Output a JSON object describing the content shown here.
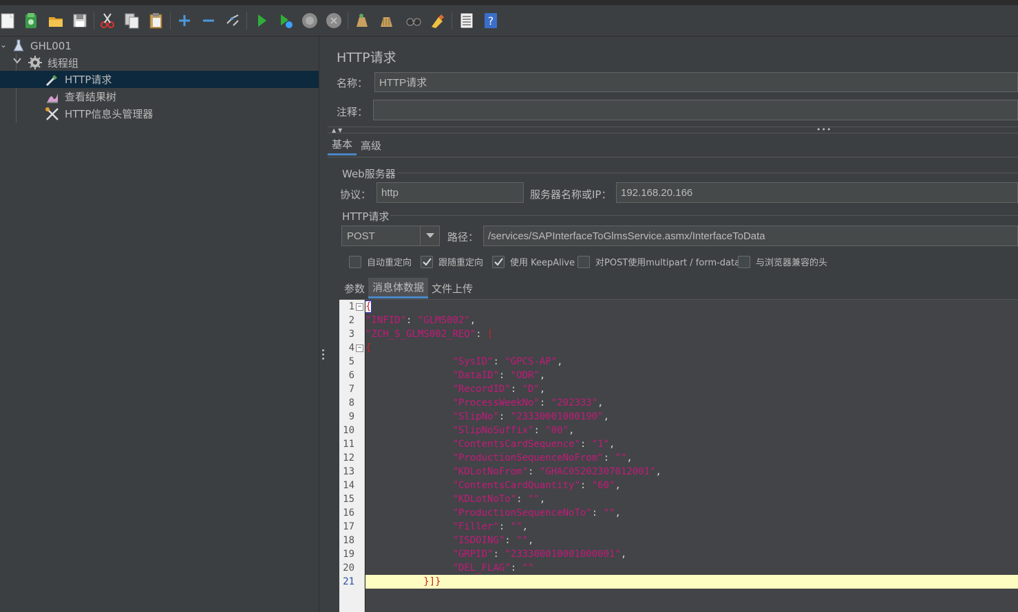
{
  "tree": {
    "root": {
      "label": "GHL001"
    },
    "thread_group": {
      "label": "线程组"
    },
    "items": [
      {
        "label": "HTTP请求",
        "selected": true
      },
      {
        "label": "查看结果树",
        "selected": false
      },
      {
        "label": "HTTP信息头管理器",
        "selected": false
      }
    ]
  },
  "panel": {
    "title": "HTTP请求",
    "name_label": "名称：",
    "name_value": "HTTP请求",
    "comment_label": "注释：",
    "comment_value": ""
  },
  "tabs": {
    "basic": "基本",
    "advanced": "高级"
  },
  "web_server": {
    "group_title": "Web服务器",
    "protocol_label": "协议：",
    "protocol_value": "http",
    "server_label": "服务器名称或IP：",
    "server_value": "192.168.20.166"
  },
  "http_request": {
    "group_title": "HTTP请求",
    "method": "POST",
    "path_label": "路径：",
    "path_value": "/services/SAPInterfaceToGlmsService.asmx/InterfaceToData"
  },
  "options": [
    {
      "label": "自动重定向",
      "checked": false
    },
    {
      "label": "跟随重定向",
      "checked": true
    },
    {
      "label": "使用 KeepAlive",
      "checked": true
    },
    {
      "label": "对POST使用multipart / form-data",
      "checked": false
    },
    {
      "label": "与浏览器兼容的头",
      "checked": false
    }
  ],
  "body_tabs": {
    "params": "参数",
    "body": "消息体数据",
    "files": "文件上传"
  },
  "editor": {
    "current_line": 21,
    "lines": [
      "1",
      "2",
      "3",
      "4",
      "5",
      "6",
      "7",
      "8",
      "9",
      "10",
      "11",
      "12",
      "13",
      "14",
      "15",
      "16",
      "17",
      "18",
      "19",
      "20",
      "21"
    ],
    "code": {
      "l1": "{",
      "l2_key": "\"INFID\"",
      "l2_val": "\"GLMS002\"",
      "l3_key": "\"ZCH_S_GLMS002_REQ\"",
      "l3_val": "[",
      "l4": "{",
      "fields": [
        {
          "key": "\"SysID\"",
          "val": "\"GPCS-AP\"",
          "end": ","
        },
        {
          "key": "\"DataID\"",
          "val": "\"ODR\"",
          "end": ","
        },
        {
          "key": "\"RecordID\"",
          "val": "\"D\"",
          "end": ","
        },
        {
          "key": "\"ProcessWeekNo\"",
          "val": "\"202333\"",
          "end": ","
        },
        {
          "key": "\"SlipNo\"",
          "val": "\"23330001000190\"",
          "end": ","
        },
        {
          "key": "\"SlipNoSuffix\"",
          "val": "\"00\"",
          "end": ","
        },
        {
          "key": "\"ContentsCardSequence\"",
          "val": "\"1\"",
          "end": ","
        },
        {
          "key": "\"ProductionSequenceNoFrom\"",
          "val": "\"\"",
          "end": ","
        },
        {
          "key": "\"KDLotNoFrom\"",
          "val": "\"GHAC05202307012001\"",
          "end": ","
        },
        {
          "key": "\"ContentsCardQuantity\"",
          "val": "\"60\"",
          "end": ","
        },
        {
          "key": "\"KDLotNoTo\"",
          "val": "\"\"",
          "end": ","
        },
        {
          "key": "\"ProductionSequenceNoTo\"",
          "val": "\"\"",
          "end": ","
        },
        {
          "key": "\"Filler\"",
          "val": "\"\"",
          "end": ","
        },
        {
          "key": "\"ISDOING\"",
          "val": "\"\"",
          "end": ","
        },
        {
          "key": "\"GRPID\"",
          "val": "\"233300010001000001\"",
          "end": ","
        },
        {
          "key": "\"DEL_FLAG\"",
          "val": "\"\"",
          "end": ""
        }
      ],
      "l21": "}]}"
    }
  }
}
